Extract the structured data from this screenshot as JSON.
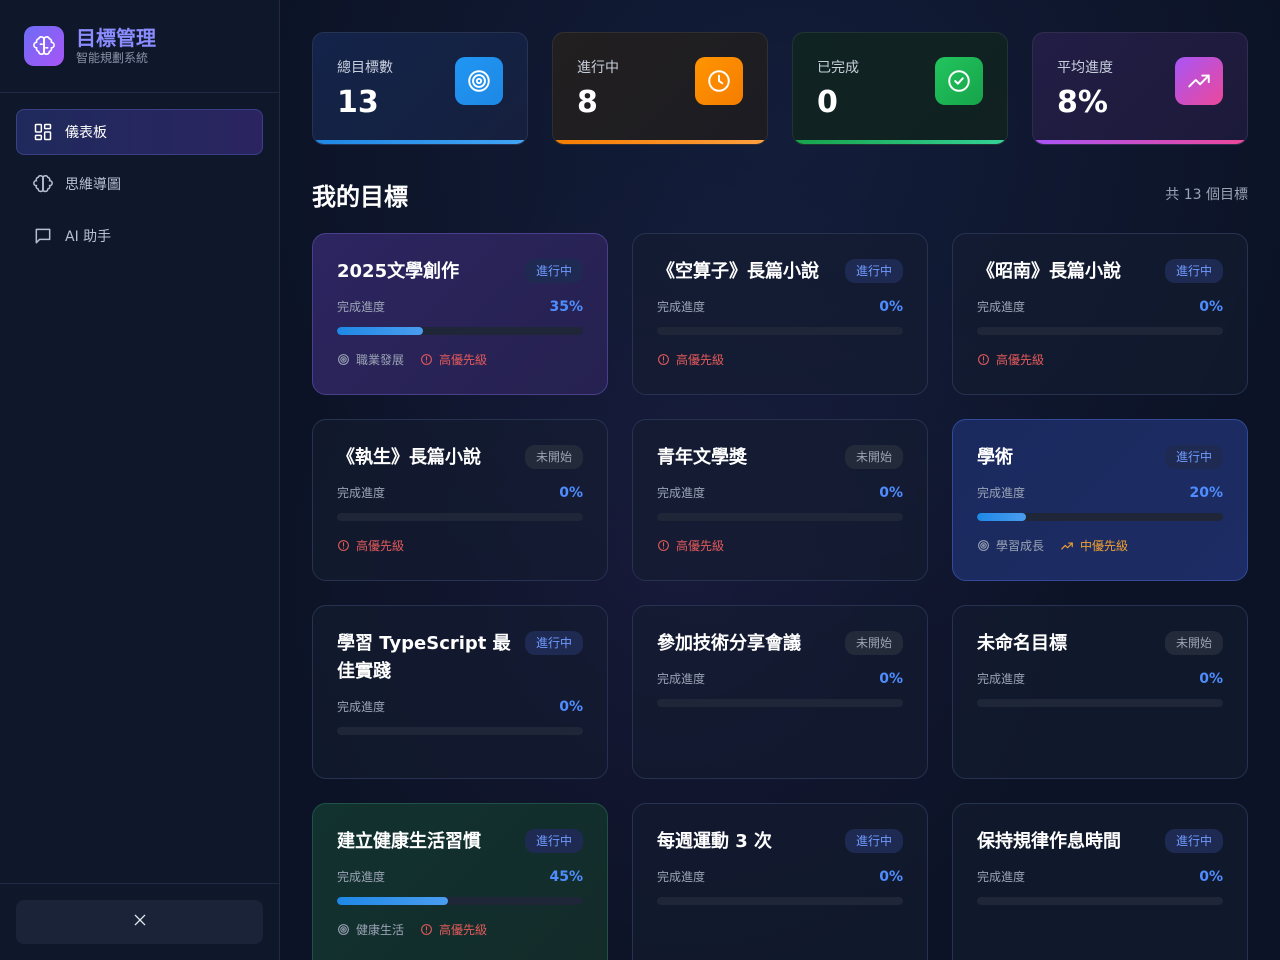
{
  "brand": {
    "title": "目標管理",
    "subtitle": "智能規劃系統"
  },
  "nav": [
    {
      "label": "儀表板",
      "icon": "dashboard-icon",
      "active": true
    },
    {
      "label": "思維導圖",
      "icon": "brain-icon",
      "active": false
    },
    {
      "label": "AI 助手",
      "icon": "chat-icon",
      "active": false
    }
  ],
  "stats": [
    {
      "label": "總目標數",
      "value": "13",
      "icon": "target-icon",
      "color": "#2196f3"
    },
    {
      "label": "進行中",
      "value": "8",
      "icon": "clock-icon",
      "color": "#ff8c00"
    },
    {
      "label": "已完成",
      "value": "0",
      "icon": "check-circle-icon",
      "color": "#1fbf60"
    },
    {
      "label": "平均進度",
      "value": "8%",
      "icon": "trend-up-icon",
      "color": "#c04de0"
    }
  ],
  "section": {
    "title": "我的目標",
    "count": "共 13 個目標"
  },
  "progress_label": "完成進度",
  "goals": [
    {
      "title": "2025文學創作",
      "status": "進行中",
      "progress": 35,
      "progress_text": "35%",
      "category": "職業發展",
      "priority": "高優先級",
      "priority_level": "high"
    },
    {
      "title": "《空算子》長篇小說",
      "status": "進行中",
      "progress": 0,
      "progress_text": "0%",
      "category": "",
      "priority": "高優先級",
      "priority_level": "high"
    },
    {
      "title": "《昭南》長篇小說",
      "status": "進行中",
      "progress": 0,
      "progress_text": "0%",
      "category": "",
      "priority": "高優先級",
      "priority_level": "high"
    },
    {
      "title": "《執生》長篇小說",
      "status": "未開始",
      "progress": 0,
      "progress_text": "0%",
      "category": "",
      "priority": "高優先級",
      "priority_level": "high"
    },
    {
      "title": "青年文學獎",
      "status": "未開始",
      "progress": 0,
      "progress_text": "0%",
      "category": "",
      "priority": "高優先級",
      "priority_level": "high"
    },
    {
      "title": "學術",
      "status": "進行中",
      "progress": 20,
      "progress_text": "20%",
      "category": "學習成長",
      "priority": "中優先級",
      "priority_level": "mid"
    },
    {
      "title": "學習 TypeScript 最佳實踐",
      "status": "進行中",
      "progress": 0,
      "progress_text": "0%",
      "category": "",
      "priority": "",
      "priority_level": ""
    },
    {
      "title": "參加技術分享會議",
      "status": "未開始",
      "progress": 0,
      "progress_text": "0%",
      "category": "",
      "priority": "",
      "priority_level": ""
    },
    {
      "title": "未命名目標",
      "status": "未開始",
      "progress": 0,
      "progress_text": "0%",
      "category": "",
      "priority": "",
      "priority_level": ""
    },
    {
      "title": "建立健康生活習慣",
      "status": "進行中",
      "progress": 45,
      "progress_text": "45%",
      "category": "健康生活",
      "priority": "高優先級",
      "priority_level": "high"
    },
    {
      "title": "每週運動 3 次",
      "status": "進行中",
      "progress": 0,
      "progress_text": "0%",
      "category": "",
      "priority": "",
      "priority_level": ""
    },
    {
      "title": "保持規律作息時間",
      "status": "進行中",
      "progress": 0,
      "progress_text": "0%",
      "category": "",
      "priority": "",
      "priority_level": ""
    }
  ]
}
